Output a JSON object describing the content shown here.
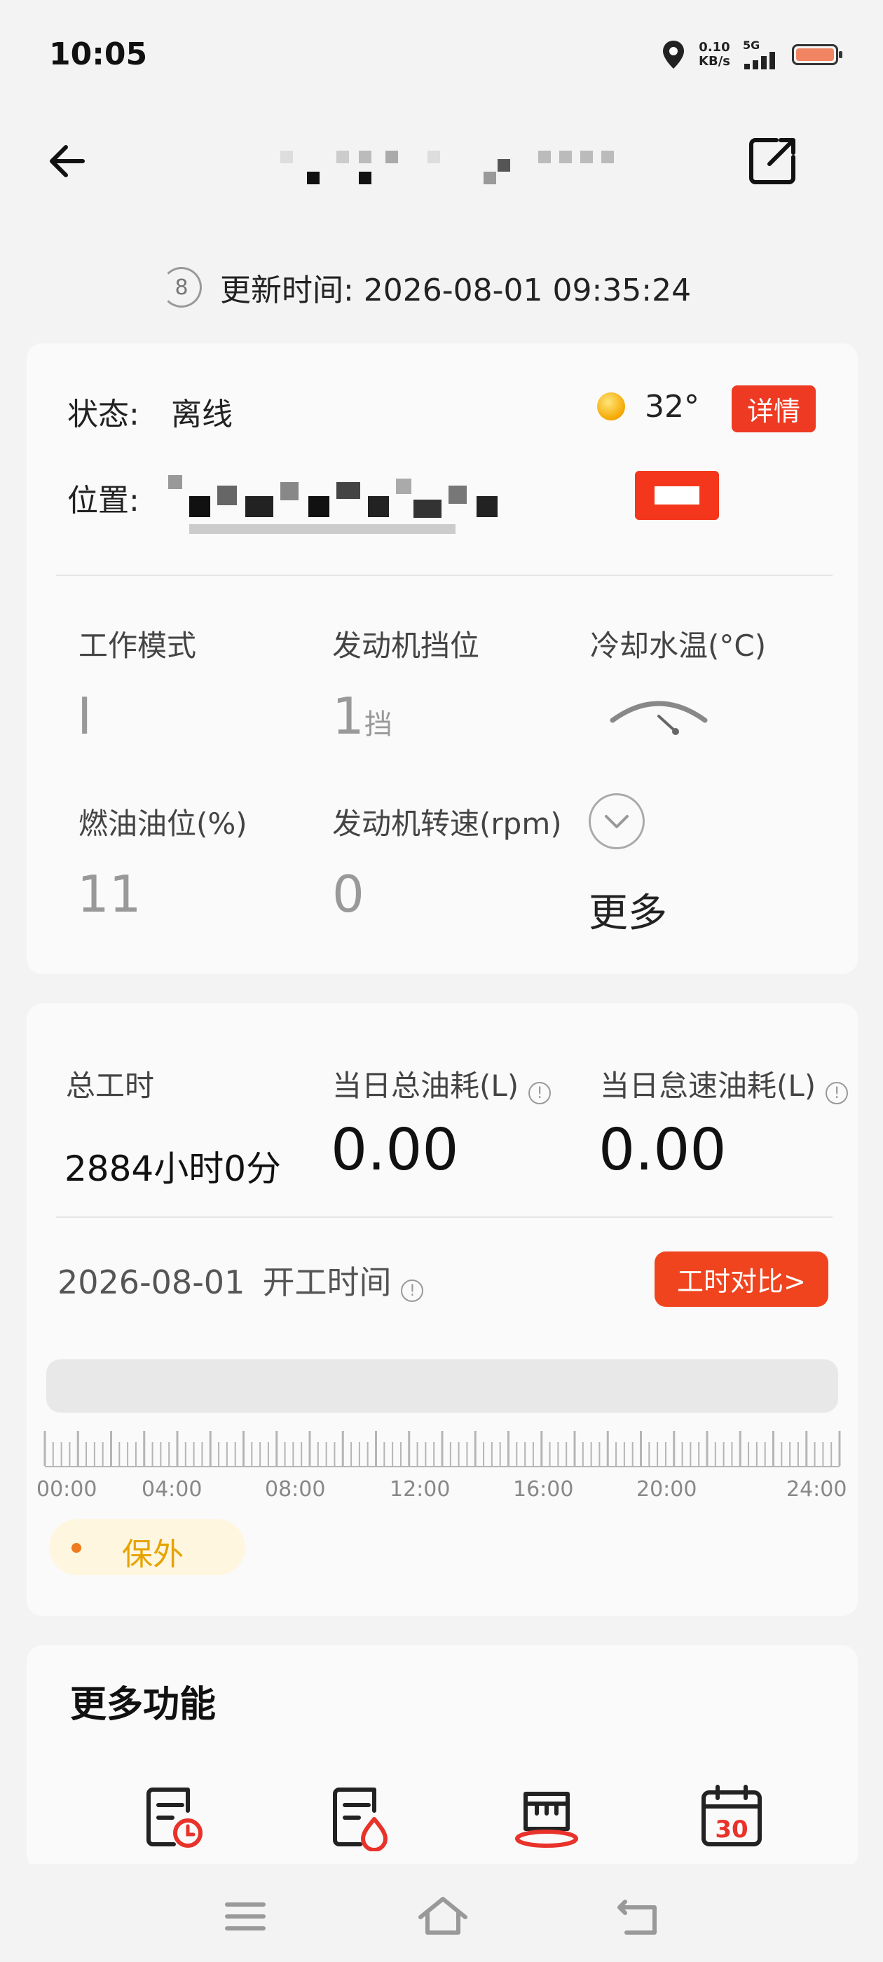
{
  "status_bar": {
    "time": "10:05",
    "net_speed_value": "0.10",
    "net_speed_unit": "KB/s",
    "network": "5G"
  },
  "header": {
    "title": ""
  },
  "update": {
    "refresh_badge": "8",
    "text": "更新时间: 2026-08-01 09:35:24"
  },
  "device": {
    "status_label": "状态:",
    "status_value": "离线",
    "temperature": "32°",
    "detail_button": "详情",
    "location_label": "位置:"
  },
  "metrics": [
    {
      "label": "工作模式",
      "value": "I",
      "unit": ""
    },
    {
      "label": "发动机挡位",
      "value": "1",
      "unit": "挡"
    },
    {
      "label": "冷却水温(°C)",
      "value": "",
      "unit": ""
    },
    {
      "label": "燃油油位(%)",
      "value": "11",
      "unit": ""
    },
    {
      "label": "发动机转速(rpm)",
      "value": "0",
      "unit": ""
    },
    {
      "label": "更多",
      "value": "",
      "unit": ""
    }
  ],
  "summary": {
    "total_hours_label": "总工时",
    "total_hours_value": "2884小时0分",
    "daily_fuel_label": "当日总油耗(L)",
    "daily_fuel_value": "0.00",
    "idle_fuel_label": "当日怠速油耗(L)",
    "idle_fuel_value": "0.00"
  },
  "work_time": {
    "date": "2026-08-01",
    "label": "开工时间",
    "compare_button": "工时对比>",
    "tick_labels": [
      "00:00",
      "04:00",
      "08:00",
      "12:00",
      "16:00",
      "20:00",
      "24:00"
    ],
    "legend": "保外"
  },
  "more_features": {
    "title": "更多功能",
    "icons": [
      "work-record-icon",
      "fuel-record-icon",
      "maintenance-icon",
      "calendar-30-icon"
    ]
  },
  "colors": {
    "accent_red": "#ee3a22",
    "accent_orange": "#f0441e",
    "legend_yellow": "#e6a300",
    "battery": "#f08463"
  }
}
